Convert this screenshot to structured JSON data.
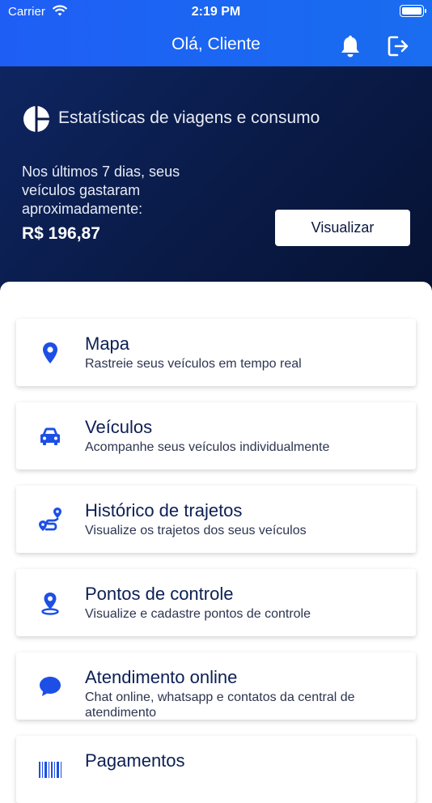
{
  "status_bar": {
    "carrier": "Carrier",
    "time": "2:19 PM"
  },
  "header": {
    "greeting": "Olá, Cliente"
  },
  "stats": {
    "title": "Estatísticas de viagens e consumo",
    "description": "Nos últimos 7 dias, seus veículos gastaram aproximadamente:",
    "amount": "R$ 196,87",
    "button_label": "Visualizar"
  },
  "menu": [
    {
      "icon": "location-pin-icon",
      "title": "Mapa",
      "subtitle": "Rastreie seus veículos em tempo real"
    },
    {
      "icon": "car-icon",
      "title": "Veículos",
      "subtitle": "Acompanhe seus veículos individualmente"
    },
    {
      "icon": "route-icon",
      "title": "Histórico de trajetos",
      "subtitle": "Visualize os trajetos dos seus veículos"
    },
    {
      "icon": "checkpoint-pin-icon",
      "title": "Pontos de controle",
      "subtitle": "Visualize e cadastre pontos de controle"
    },
    {
      "icon": "chat-icon",
      "title": "Atendimento online",
      "subtitle": "Chat online, whatsapp e contatos da central de atendimento"
    },
    {
      "icon": "barcode-icon",
      "title": "Pagamentos",
      "subtitle": ""
    }
  ],
  "colors": {
    "header_blue": "#1f5ef5",
    "hero_navy": "#0a1b48",
    "accent_blue": "#1d4fe6",
    "title_navy": "#0c1f55"
  }
}
